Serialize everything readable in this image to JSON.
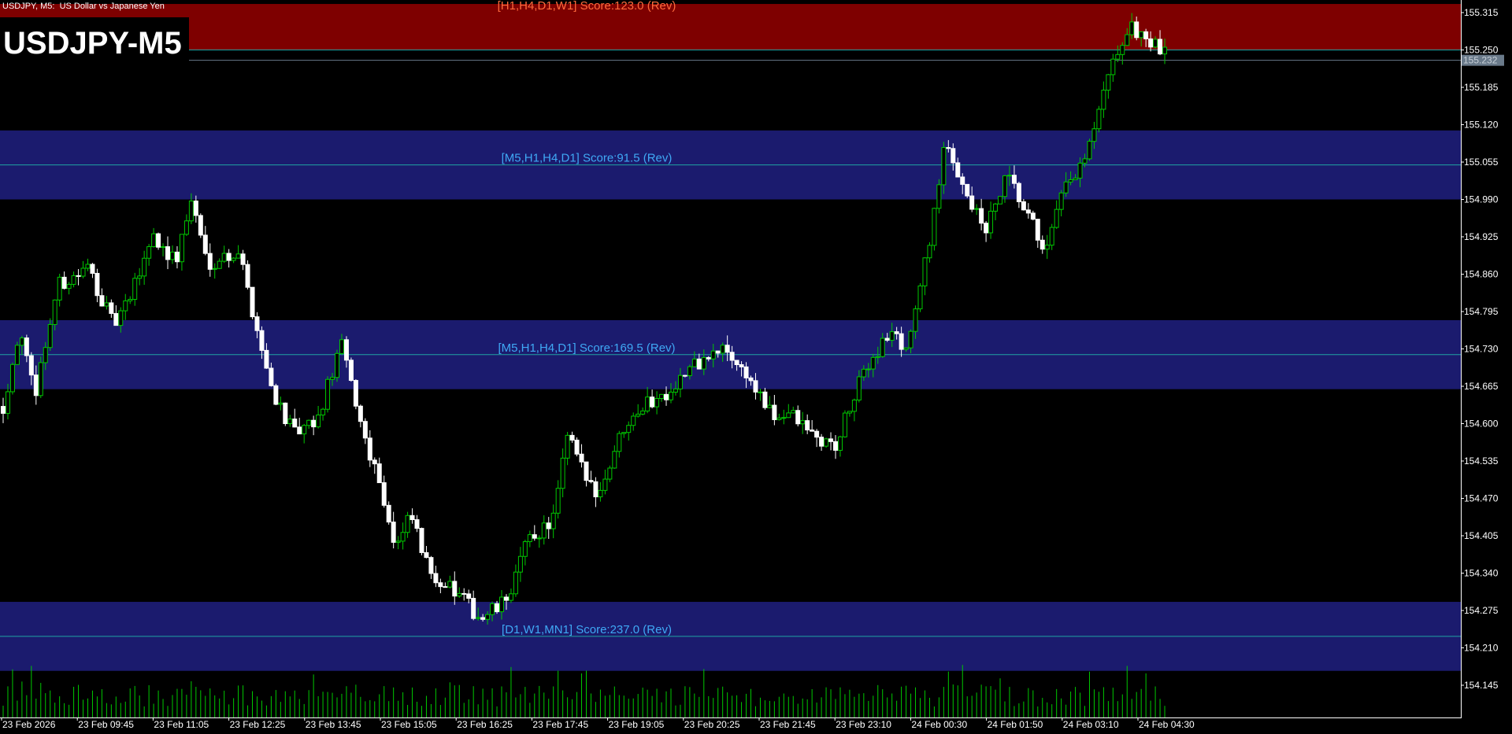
{
  "window": {
    "header_symbol": "USDJPY, M5:",
    "header_desc": "US Dollar vs Japanese Yen",
    "symbol_label": "USDJPY-M5"
  },
  "price_axis": {
    "ticks": [
      "155.315",
      "155.250",
      "155.185",
      "155.120",
      "155.055",
      "154.990",
      "154.925",
      "154.860",
      "154.795",
      "154.730",
      "154.665",
      "154.600",
      "154.535",
      "154.470",
      "154.405",
      "154.340",
      "154.275",
      "154.210",
      "154.145"
    ],
    "current_price": "155.232"
  },
  "time_axis": {
    "ticks": [
      "23 Feb 2026",
      "23 Feb 09:45",
      "23 Feb 11:05",
      "23 Feb 12:25",
      "23 Feb 13:45",
      "23 Feb 15:05",
      "23 Feb 16:25",
      "23 Feb 17:45",
      "23 Feb 19:05",
      "23 Feb 20:25",
      "23 Feb 21:45",
      "23 Feb 23:10",
      "24 Feb 00:30",
      "24 Feb 01:50",
      "24 Feb 03:10",
      "24 Feb 04:30"
    ]
  },
  "zones": [
    {
      "label": "[H1,H4,D1,W1] Score:123.0 (Rev)",
      "type": "resistance",
      "top": 155.33,
      "bottom": 155.25,
      "line": 155.25
    },
    {
      "label": "[M5,H1,H4,D1] Score:91.5 (Rev)",
      "type": "support",
      "top": 155.11,
      "bottom": 154.99,
      "line": 155.05
    },
    {
      "label": "[M5,H1,H4,D1] Score:169.5 (Rev)",
      "type": "support",
      "top": 154.78,
      "bottom": 154.66,
      "line": 154.72
    },
    {
      "label": "[D1,W1,MN1] Score:237.0 (Rev)",
      "type": "support",
      "top": 154.29,
      "bottom": 154.17,
      "line": 154.23
    }
  ],
  "colors": {
    "background": "#000000",
    "bull_candle": "#00c800",
    "bear_candle": "#ffffff",
    "resistance_zone": "#7e0000",
    "support_zone": "#1b1b6e",
    "zone_line": "#1fa3a3",
    "support_label": "#3fa9f5",
    "resistance_label": "#ff6b3d",
    "axis_text": "#ffffff",
    "volume": "#00c800"
  },
  "chart_data": {
    "type": "candlestick",
    "y_range": [
      154.11,
      155.34
    ],
    "waypoints": [
      [
        0,
        154.63
      ],
      [
        10,
        154.76
      ],
      [
        20,
        154.65
      ],
      [
        35,
        154.84
      ],
      [
        55,
        154.87
      ],
      [
        70,
        154.77
      ],
      [
        80,
        154.81
      ],
      [
        95,
        154.93
      ],
      [
        110,
        154.88
      ],
      [
        120,
        154.99
      ],
      [
        130,
        154.88
      ],
      [
        150,
        154.9
      ],
      [
        170,
        154.67
      ],
      [
        185,
        154.58
      ],
      [
        200,
        154.6
      ],
      [
        215,
        154.74
      ],
      [
        230,
        154.58
      ],
      [
        240,
        154.5
      ],
      [
        250,
        154.38
      ],
      [
        260,
        154.44
      ],
      [
        270,
        154.35
      ],
      [
        290,
        154.3
      ],
      [
        305,
        154.26
      ],
      [
        320,
        154.29
      ],
      [
        335,
        154.4
      ],
      [
        350,
        154.43
      ],
      [
        360,
        154.58
      ],
      [
        370,
        154.51
      ],
      [
        380,
        154.48
      ],
      [
        390,
        154.56
      ],
      [
        400,
        154.62
      ],
      [
        420,
        154.65
      ],
      [
        440,
        154.7
      ],
      [
        460,
        154.73
      ],
      [
        475,
        154.68
      ],
      [
        490,
        154.61
      ],
      [
        500,
        154.62
      ],
      [
        520,
        154.57
      ],
      [
        530,
        154.56
      ],
      [
        540,
        154.63
      ],
      [
        550,
        154.7
      ],
      [
        565,
        154.76
      ],
      [
        575,
        154.73
      ],
      [
        585,
        154.84
      ],
      [
        600,
        155.08
      ],
      [
        610,
        155.03
      ],
      [
        625,
        154.93
      ],
      [
        640,
        155.03
      ],
      [
        650,
        154.97
      ],
      [
        665,
        154.9
      ],
      [
        675,
        155.0
      ],
      [
        690,
        155.06
      ],
      [
        700,
        155.16
      ],
      [
        710,
        155.25
      ],
      [
        720,
        155.29
      ],
      [
        740,
        155.24
      ]
    ]
  }
}
